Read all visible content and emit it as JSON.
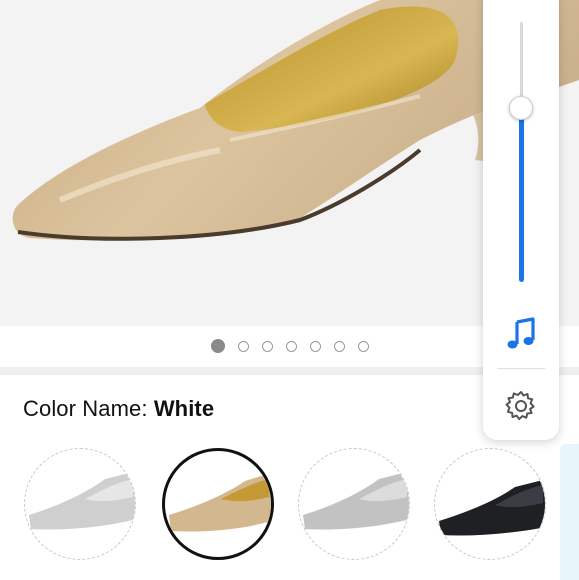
{
  "product_image": {
    "carousel": {
      "count": 7,
      "active_index": 0
    }
  },
  "color": {
    "label": "Color Name:",
    "value": "White"
  },
  "swatches": [
    {
      "name": "silver-gray",
      "selected": false
    },
    {
      "name": "nude-patent",
      "selected": true
    },
    {
      "name": "silver-metallic",
      "selected": false
    },
    {
      "name": "black",
      "selected": false
    }
  ],
  "volume_panel": {
    "level_fraction": 0.8,
    "accent": "#1a73e8",
    "media_icon": "music-note-icon",
    "settings_icon": "gear-icon"
  }
}
